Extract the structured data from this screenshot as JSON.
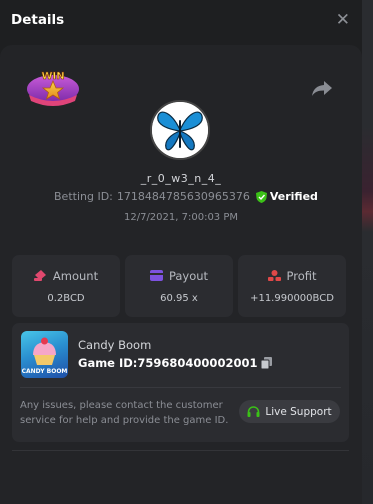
{
  "header": {
    "title": "Details"
  },
  "win_badge": {
    "text": "WIN"
  },
  "user": {
    "username": "_r_0_w3_n_4_",
    "betting_id_label": "Betting ID:",
    "betting_id": "171848478563096537​6",
    "verified_label": "Verified",
    "datetime": "12/7/2021, 7:00:03 PM"
  },
  "stats": [
    {
      "label": "Amount",
      "value": "0.2BCD",
      "icon": "cash-icon",
      "icon_color": "#e0486e"
    },
    {
      "label": "Payout",
      "value": "60.95 x",
      "icon": "card-icon",
      "icon_color": "#7d52e0"
    },
    {
      "label": "Profit",
      "value": "+11.990000BCD",
      "icon": "coins-icon",
      "icon_color": "#e04848"
    }
  ],
  "game": {
    "name": "Candy Boom",
    "id_label": "Game ID:",
    "id": "759680400002001",
    "thumb_text": "CANDY BOOM"
  },
  "support": {
    "help_text": "Any issues, please contact the customer service for help and provide the game ID.",
    "button_label": "Live Support"
  },
  "colors": {
    "accent_green": "#3bc117",
    "background": "#1e1f21",
    "panel": "#232427",
    "card": "#2b2c30"
  }
}
